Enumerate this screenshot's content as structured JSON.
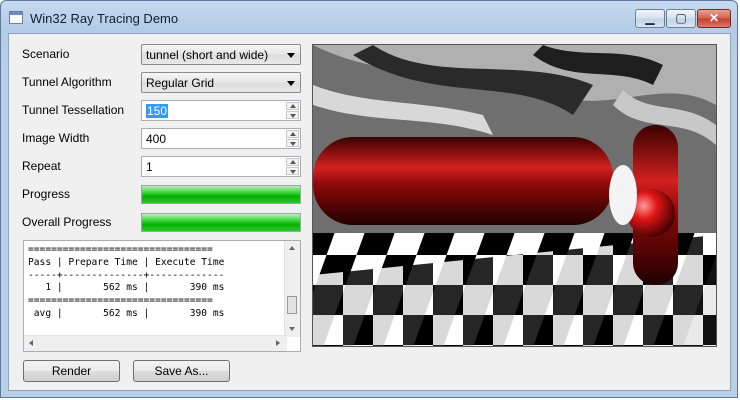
{
  "window": {
    "title": "Win32 Ray Tracing Demo",
    "min_glyph": "▁",
    "max_glyph": "▢",
    "close_glyph": "✕"
  },
  "form": {
    "scenario_label": "Scenario",
    "scenario_value": "tunnel (short and wide)",
    "algorithm_label": "Tunnel Algorithm",
    "algorithm_value": "Regular Grid",
    "tessellation_label": "Tunnel Tessellation",
    "tessellation_value": "150",
    "width_label": "Image Width",
    "width_value": "400",
    "repeat_label": "Repeat",
    "repeat_value": "1",
    "progress_label": "Progress",
    "progress_fraction": 1.0,
    "overall_label": "Overall Progress",
    "overall_fraction": 1.0
  },
  "log": {
    "lines": [
      "================================",
      "Pass | Prepare Time | Execute Time",
      "-----+--------------+-------------",
      "   1 |       562 ms |       390 ms",
      "================================",
      " avg |       562 ms |       390 ms"
    ]
  },
  "buttons": {
    "render": "Render",
    "save_as": "Save As..."
  },
  "render_colors": {
    "floor_dark": "#000000",
    "floor_light": "#ffffff",
    "tube": "#c01010",
    "sphere": "#d81818",
    "wall": "#7f7f7f"
  }
}
